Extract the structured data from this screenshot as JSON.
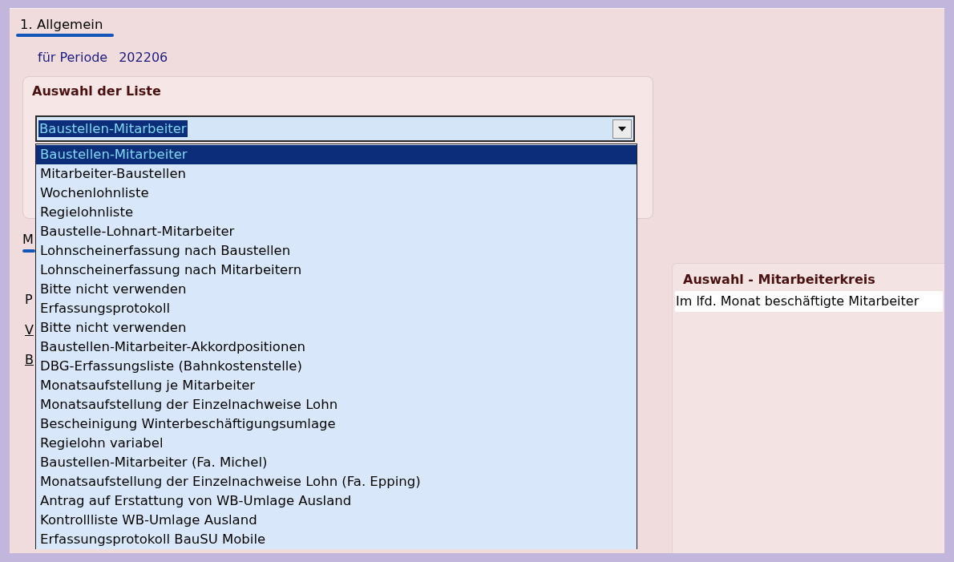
{
  "section": {
    "title": "1. Allgemein"
  },
  "period": {
    "label": "für Periode",
    "value": "202206"
  },
  "list_group": {
    "title": "Auswahl der Liste",
    "combo": {
      "value": "Baustellen-Mitarbeiter",
      "expanded": true,
      "focused": true
    },
    "options": [
      {
        "label": "Baustellen-Mitarbeiter",
        "selected": true
      },
      {
        "label": "Mitarbeiter-Baustellen",
        "selected": false
      },
      {
        "label": "Wochenlohnliste",
        "selected": false
      },
      {
        "label": "Regielohnliste",
        "selected": false
      },
      {
        "label": "Baustelle-Lohnart-Mitarbeiter",
        "selected": false
      },
      {
        "label": "Lohnscheinerfassung nach Baustellen",
        "selected": false
      },
      {
        "label": "Lohnscheinerfassung nach Mitarbeitern",
        "selected": false
      },
      {
        "label": "Bitte nicht verwenden",
        "selected": false
      },
      {
        "label": "Erfassungsprotokoll",
        "selected": false
      },
      {
        "label": "Bitte nicht verwenden",
        "selected": false
      },
      {
        "label": "Baustellen-Mitarbeiter-Akkordpositionen",
        "selected": false
      },
      {
        "label": "DBG-Erfassungsliste (Bahnkostenstelle)",
        "selected": false
      },
      {
        "label": "Monatsaufstellung je Mitarbeiter",
        "selected": false
      },
      {
        "label": "Monatsaufstellung der Einzelnachweise Lohn",
        "selected": false
      },
      {
        "label": "Bescheinigung Winterbeschäftigungsumlage",
        "selected": false
      },
      {
        "label": "Regielohn variabel",
        "selected": false
      },
      {
        "label": "Baustellen-Mitarbeiter (Fa. Michel)",
        "selected": false
      },
      {
        "label": "Monatsaufstellung der Einzelnachweise Lohn (Fa. Epping)",
        "selected": false
      },
      {
        "label": "Antrag auf Erstattung von WB-Umlage Ausland",
        "selected": false
      },
      {
        "label": "Kontrollliste WB-Umlage Ausland",
        "selected": false
      },
      {
        "label": "Erfassungsprotokoll BauSU Mobile",
        "selected": false
      }
    ]
  },
  "covered_labels": [
    {
      "text": "M",
      "kind": "section"
    },
    {
      "text": "P",
      "kind": "label"
    },
    {
      "text": "V",
      "kind": "accel"
    },
    {
      "text": "B",
      "kind": "accel"
    }
  ],
  "employee_group": {
    "title": "Auswahl - Mitarbeiterkreis",
    "value": "Im lfd. Monat beschäftigte Mitarbeiter"
  }
}
